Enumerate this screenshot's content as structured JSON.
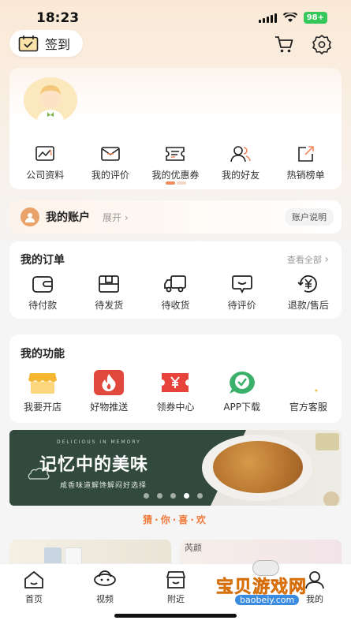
{
  "status_bar": {
    "time": "18:23",
    "battery": "98+"
  },
  "header": {
    "checkin_label": "签到"
  },
  "quick_links": [
    {
      "label": "公司资料",
      "icon": "chart-board-icon"
    },
    {
      "label": "我的评价",
      "icon": "envelope-icon"
    },
    {
      "label": "我的优惠券",
      "icon": "coupon-icon"
    },
    {
      "label": "我的好友",
      "icon": "friends-icon"
    },
    {
      "label": "热销榜单",
      "icon": "share-box-icon"
    }
  ],
  "account": {
    "title": "我的账户",
    "expand": "展开",
    "explain_button": "账户说明"
  },
  "orders": {
    "title": "我的订单",
    "see_all": "查看全部",
    "items": [
      {
        "label": "待付款",
        "icon": "wallet-icon"
      },
      {
        "label": "待发货",
        "icon": "package-icon"
      },
      {
        "label": "待收货",
        "icon": "truck-icon"
      },
      {
        "label": "待评价",
        "icon": "comment-icon"
      },
      {
        "label": "退款/售后",
        "icon": "yen-refund-icon"
      }
    ]
  },
  "functions": {
    "title": "我的功能",
    "items": [
      {
        "label": "我要开店",
        "icon": "store-icon",
        "color": "#f5b731"
      },
      {
        "label": "好物推送",
        "icon": "flame-icon",
        "color": "#e0483c"
      },
      {
        "label": "领券中心",
        "icon": "yen-ticket-icon",
        "color": "#e8433a"
      },
      {
        "label": "APP下载",
        "icon": "check-bubble-icon",
        "color": "#3bb06a"
      },
      {
        "label": "官方客服",
        "icon": "service-icon",
        "color": "#f0b84a"
      }
    ]
  },
  "banner": {
    "subtitle": "DELICIOUS IN MEMORY",
    "title": "记忆中的美味",
    "description": "咸香味道解馋解闷好选择",
    "active_slide": 4,
    "slide_count": 5
  },
  "recommend_title": "猜·你·喜·欢",
  "recommend_peek_text": "芮颜",
  "tabs": [
    {
      "label": "首页",
      "icon": "home-icon"
    },
    {
      "label": "视频",
      "icon": "video-planet-icon"
    },
    {
      "label": "附近",
      "icon": "nearby-shop-icon"
    },
    {
      "label": "我的",
      "icon": "profile-icon"
    }
  ],
  "watermark": {
    "text": "宝贝游戏网",
    "url": "baobeiy.com"
  },
  "colors": {
    "accent": "#f07a3b",
    "banner_green": "#324a3e"
  }
}
